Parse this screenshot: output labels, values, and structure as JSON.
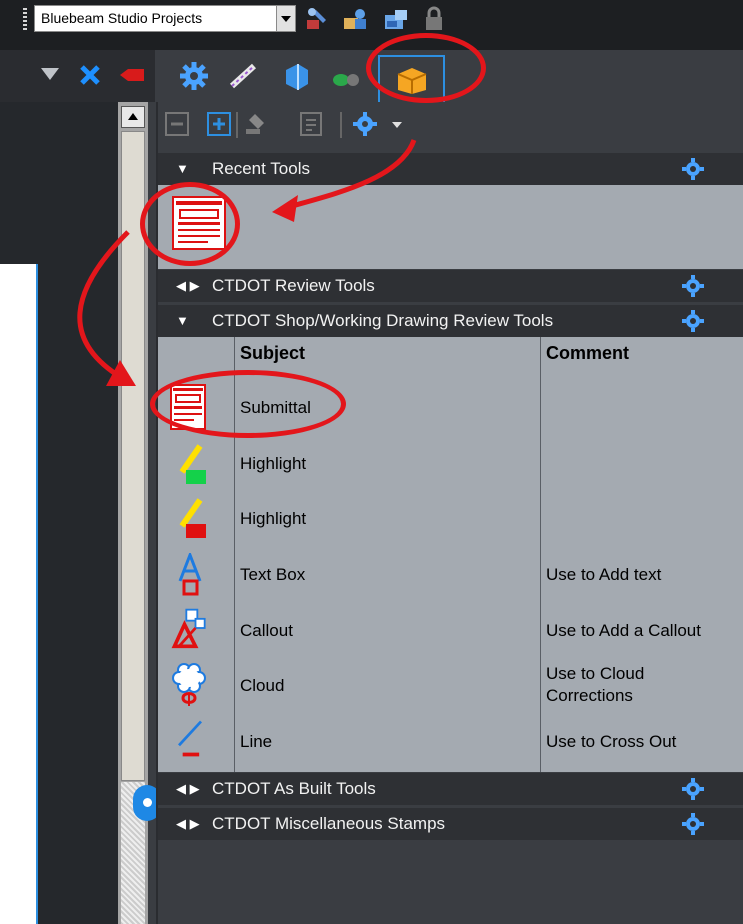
{
  "toolbar": {
    "project_combo_value": "Bluebeam Studio Projects",
    "icons": [
      "wrench-icon",
      "people-icon",
      "folder-sync-icon",
      "lock-icon"
    ]
  },
  "header_left_icons": [
    "triangle-down-icon",
    "close-x-icon",
    "red-marker-icon"
  ],
  "tabs": [
    "settings-icon",
    "measure-icon",
    "3d-icon",
    "links-icon",
    "tool-chest-icon"
  ],
  "panel_toolbar": [
    "collapse-all-icon",
    "expand-all-icon",
    "stamp-icon",
    "checklist-icon",
    "gear-menu-icon"
  ],
  "sections": {
    "recent": {
      "label": "Recent Tools"
    },
    "review": {
      "label": "CTDOT Review Tools"
    },
    "shop": {
      "label": "CTDOT Shop/Working Drawing Review Tools"
    },
    "asbuilt": {
      "label": "CTDOT As Built Tools"
    },
    "misc": {
      "label": "CTDOT Miscellaneous Stamps"
    }
  },
  "table": {
    "col_subject": "Subject",
    "col_comment": "Comment",
    "rows": [
      {
        "icon": "submittal-stamp-icon",
        "subject": "Submittal",
        "comment": ""
      },
      {
        "icon": "highlight-green-icon",
        "subject": "Highlight",
        "comment": ""
      },
      {
        "icon": "highlight-red-icon",
        "subject": "Highlight",
        "comment": ""
      },
      {
        "icon": "text-box-icon",
        "subject": "Text Box",
        "comment": "Use to Add text"
      },
      {
        "icon": "callout-icon",
        "subject": "Callout",
        "comment": "Use to Add a Callout"
      },
      {
        "icon": "cloud-icon",
        "subject": "Cloud",
        "comment_line1": "Use to Cloud",
        "comment_line2": "Corrections"
      },
      {
        "icon": "line-icon",
        "subject": "Line",
        "comment": "Use to Cross Out"
      }
    ]
  },
  "colors": {
    "accent_blue": "#2d8fe0",
    "annotation_red": "#e3161b",
    "table_bg": "#a4aab1",
    "header_bg": "#2e3034"
  }
}
